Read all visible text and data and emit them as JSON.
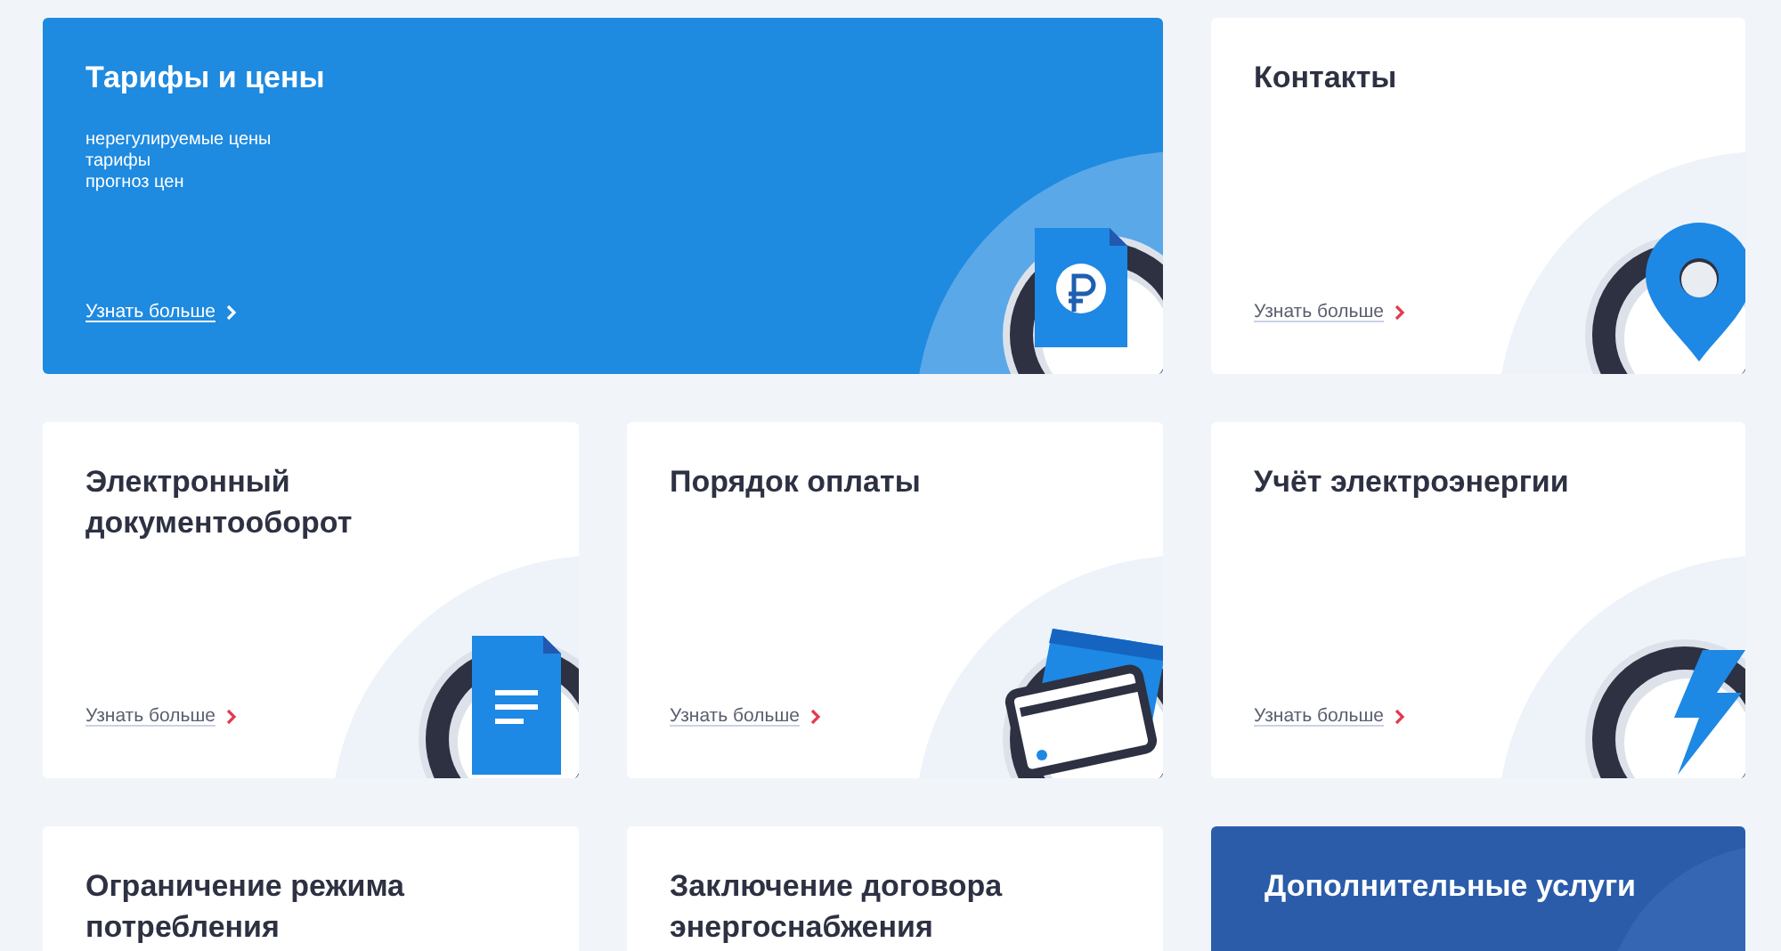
{
  "cards": [
    {
      "kind": "featured",
      "title": "Тарифы и цены",
      "items": [
        "нерегулируемые цены",
        "тарифы",
        "прогноз цен"
      ],
      "more": "Узнать больше"
    },
    {
      "kind": "plain",
      "title": "Контакты",
      "more": "Узнать больше"
    },
    {
      "kind": "plain",
      "title": "Электронный документооборот",
      "more": "Узнать больше"
    },
    {
      "kind": "plain",
      "title": "Порядок оплаты",
      "more": "Узнать больше"
    },
    {
      "kind": "plain",
      "title": "Учёт электроэнергии",
      "more": "Узнать больше"
    },
    {
      "kind": "plain",
      "title": "Ограничение режима потребления"
    },
    {
      "kind": "plain",
      "title": "Заключение договора энергоснабжения"
    },
    {
      "kind": "dark",
      "title": "Дополнительные услуги"
    }
  ]
}
